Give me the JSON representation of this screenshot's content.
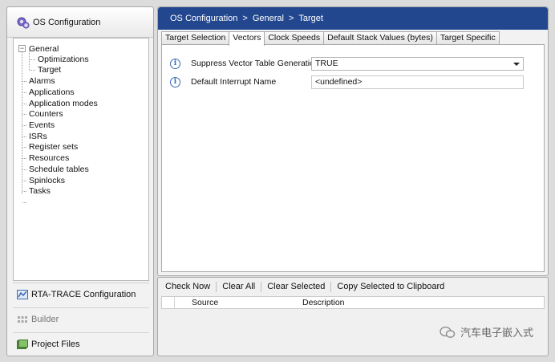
{
  "sidebar": {
    "header_title": "OS Configuration",
    "tree": [
      {
        "label": "General",
        "expanded": true,
        "children": [
          "Optimizations",
          "Target"
        ]
      },
      {
        "label": "Alarms"
      },
      {
        "label": "Applications"
      },
      {
        "label": "Application modes"
      },
      {
        "label": "Counters"
      },
      {
        "label": "Events"
      },
      {
        "label": "ISRs"
      },
      {
        "label": "Register sets"
      },
      {
        "label": "Resources"
      },
      {
        "label": "Schedule tables"
      },
      {
        "label": "Spinlocks"
      },
      {
        "label": "Tasks"
      }
    ],
    "expander_glyph": "−",
    "buttons": [
      {
        "label": "RTA-TRACE Configuration",
        "icon": "trace-icon"
      },
      {
        "label": "Builder",
        "icon": "builder-icon"
      },
      {
        "label": "Project Files",
        "icon": "project-files-icon"
      }
    ]
  },
  "breadcrumb": [
    "OS Configuration",
    "General",
    "Target"
  ],
  "breadcrumb_separator": ">",
  "tabs": [
    {
      "label": "Target Selection",
      "active": false
    },
    {
      "label": "Vectors",
      "active": true
    },
    {
      "label": "Clock Speeds",
      "active": false
    },
    {
      "label": "Default Stack Values (bytes)",
      "active": false
    },
    {
      "label": "Target Specific",
      "active": false
    }
  ],
  "properties": [
    {
      "label": "Suppress Vector Table Generation",
      "value": "TRUE",
      "type": "select",
      "info_glyph": "i"
    },
    {
      "label": "Default Interrupt Name",
      "value": "<undefined>",
      "type": "text",
      "info_glyph": "i"
    }
  ],
  "toolbar": {
    "check_now": "Check Now",
    "clear_all": "Clear All",
    "clear_selected": "Clear Selected",
    "copy_selected": "Copy Selected to Clipboard"
  },
  "grid": {
    "columns": [
      "Source",
      "Description"
    ]
  },
  "watermark": {
    "text": "汽车电子嵌入式"
  },
  "colors": {
    "breadcrumb_bar": "#23478f",
    "info_icon": "#3b6bb5"
  }
}
